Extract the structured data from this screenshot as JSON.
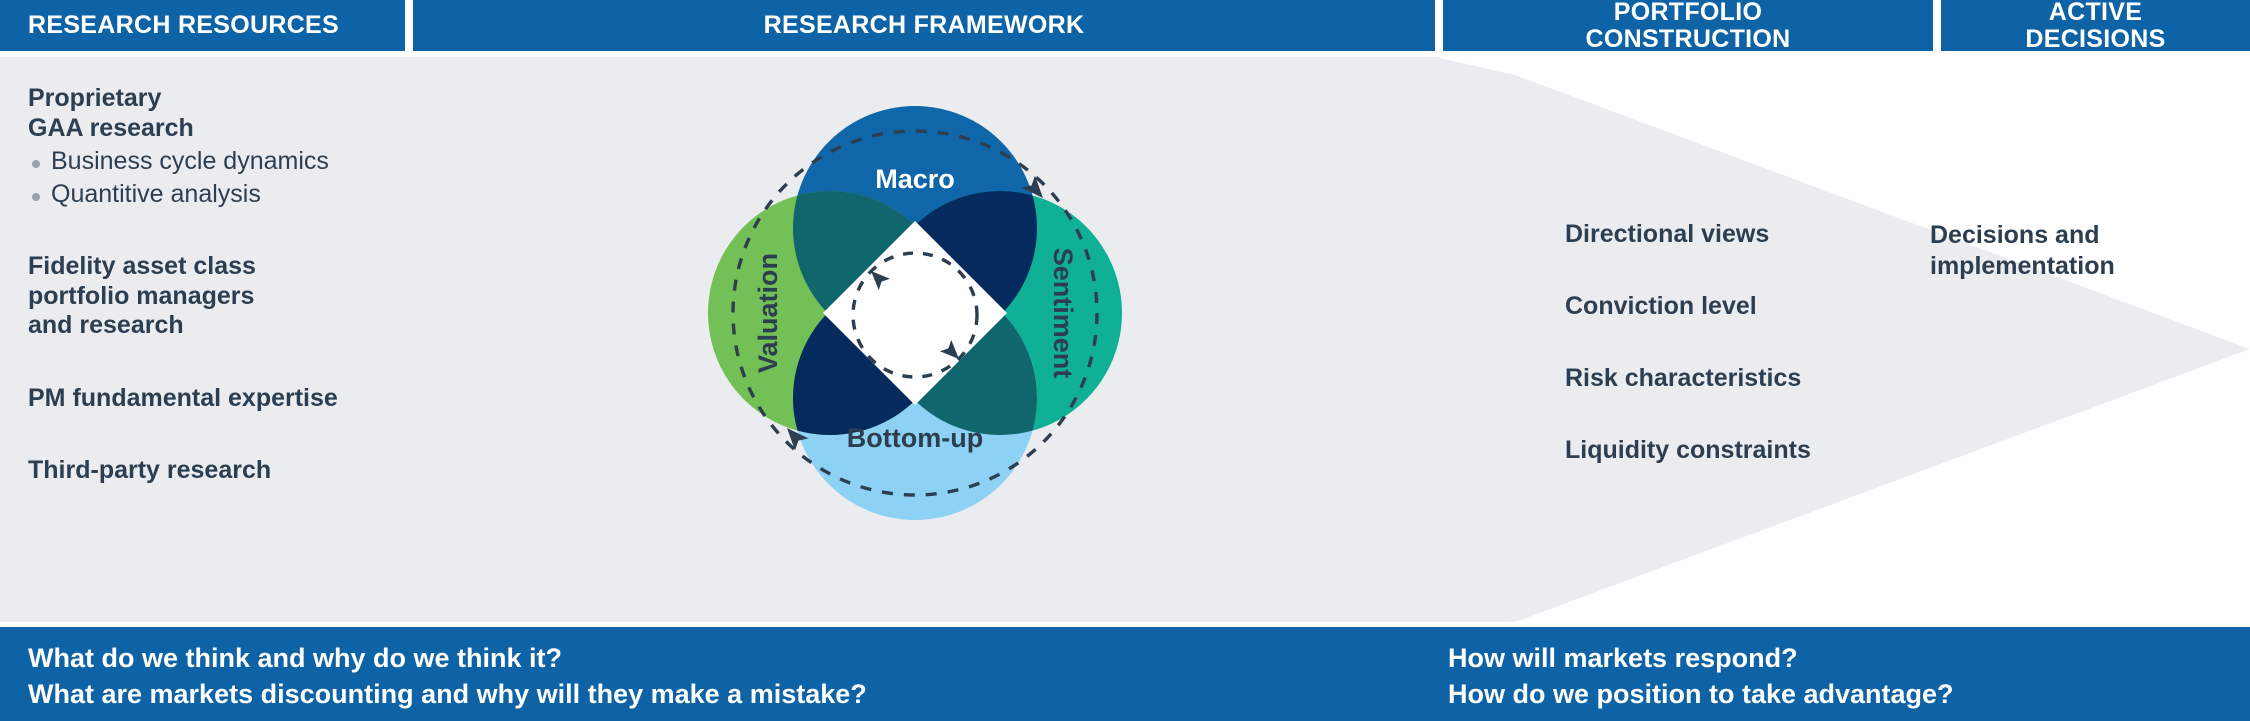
{
  "header": {
    "columns": [
      {
        "label": "RESEARCH RESOURCES"
      },
      {
        "label": "RESEARCH FRAMEWORK"
      },
      {
        "label_line1": "PORTFOLIO",
        "label_line2": "CONSTRUCTION"
      },
      {
        "label_line1": "ACTIVE",
        "label_line2": "DECISIONS"
      }
    ]
  },
  "research_resources": {
    "blocks": [
      {
        "heading_line1": "Proprietary",
        "heading_line2": "GAA research",
        "bullets": [
          "Business cycle dynamics",
          "Quantitive analysis"
        ]
      },
      {
        "heading_line1": "Fidelity asset class",
        "heading_line2": "portfolio managers",
        "heading_line3": "and research",
        "bullets": []
      },
      {
        "heading_line1": "PM fundamental expertise",
        "bullets": []
      },
      {
        "heading_line1": "Third-party research",
        "bullets": []
      }
    ]
  },
  "research_framework": {
    "circles": [
      {
        "label": "Macro",
        "color": "#0f66a8",
        "text_color": "#ffffff",
        "position": "top"
      },
      {
        "label": "Sentiment",
        "color": "#10b096",
        "text_color": "#2d3e50",
        "position": "right"
      },
      {
        "label": "Bottom-up",
        "color": "#8dd2f4",
        "text_color": "#2d3e50",
        "position": "bottom"
      },
      {
        "label": "Valuation",
        "color": "#73c056",
        "text_color": "#2d3e50",
        "position": "left"
      }
    ],
    "overlap_colors": {
      "macro_valuation": "#11666e",
      "macro_sentiment": "#042a5e",
      "valuation_bottomup": "#042a5e",
      "sentiment_bottomup": "#11666e",
      "center": "#ffffff"
    },
    "outer_ring": "dashed-circle-arrows",
    "inner_ring": "dashed-circle-arrows",
    "ring_color": "#2d3e50"
  },
  "portfolio_construction": {
    "items": [
      "Directional views",
      "Conviction level",
      "Risk characteristics",
      "Liquidity constraints"
    ]
  },
  "active_decisions": {
    "line1": "Decisions and",
    "line2": "implementation"
  },
  "bottom_bar": {
    "left": {
      "line1": "What do we think and why do we think it?",
      "line2": "What are markets discounting and why will they make a mistake?"
    },
    "right": {
      "line1": "How will markets respond?",
      "line2": "How do we position to take advantage?"
    }
  },
  "colors": {
    "header_blue": "#0d63a5",
    "body_grey": "#ebecef",
    "text_dark": "#2d3e50",
    "bullet_grey": "#9aa3ae"
  }
}
